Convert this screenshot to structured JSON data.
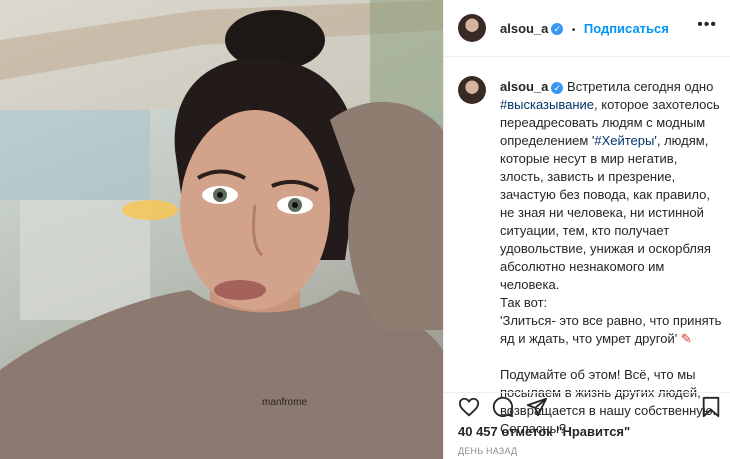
{
  "header": {
    "username": "alsou_a",
    "separator": "•",
    "follow_label": "Подписаться",
    "more": "•••"
  },
  "caption": {
    "username": "alsou_a",
    "p1_a": "Встретила сегодня одно ",
    "tag1": "#высказывание",
    "p1_b": ", которое захотелось переадресовать людям с модным определением '",
    "tag2": "#Хейтеры",
    "p1_c": "', людям, которые несут в мир негатив, злость, зависть и презрение, зачастую без повода, как правило, не зная ни человека, ни истинной ситуации, тем, кто получает удовольствие, унижая и оскорбляя абсолютно незнакомого им человека.",
    "p2": "Так вот:",
    "p3": "'Злиться- это все равно, что принять яд и ждать, что умрет другой'",
    "p4": "Подумайте об этом! Всё, что мы посылаем в жизнь других людей, возвращается в нашу собственную. Согласны?"
  },
  "likes": "40 457 отметок \"Нравится\"",
  "time": "ДЕНЬ НАЗАД",
  "photo": {
    "sweater_text": "manfrome"
  },
  "icons": [
    "heart-icon",
    "comment-icon",
    "share-icon",
    "bookmark-icon",
    "verified-icon",
    "more-icon",
    "pushpin-icon"
  ],
  "colors": {
    "accent": "#0095f6",
    "hashtag": "#00376b",
    "verified": "#3897f0",
    "muted": "#8e8e8e"
  }
}
